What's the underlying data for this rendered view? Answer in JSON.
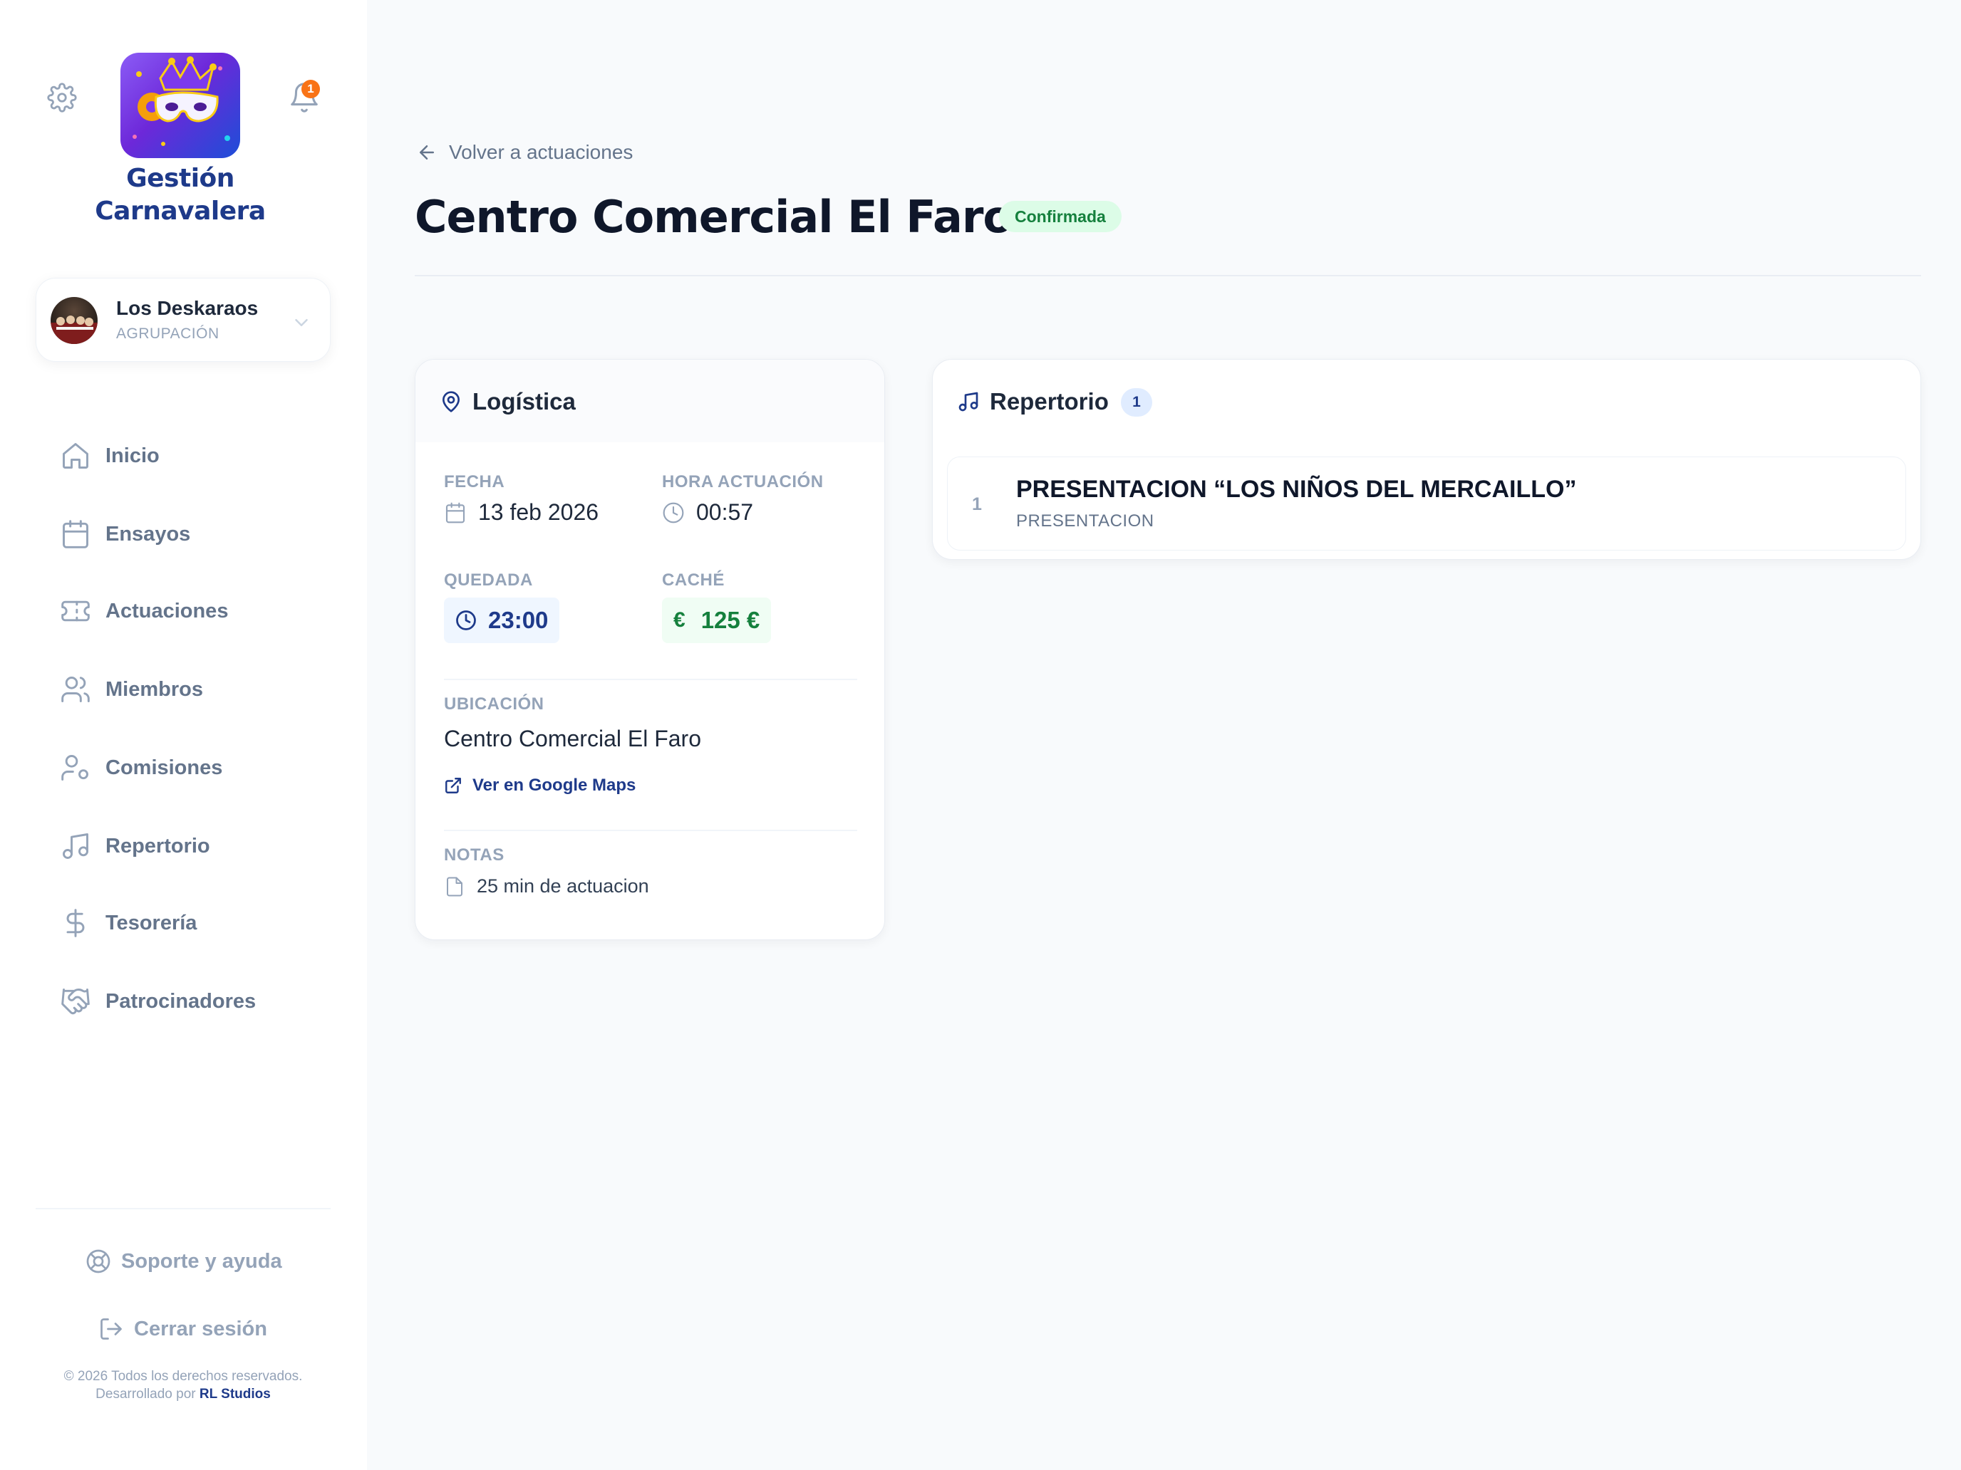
{
  "app": {
    "logo_line1": "Gestión",
    "logo_line2": "Carnavalera",
    "notifications_count": "1"
  },
  "group": {
    "name": "Los Deskaraos",
    "type": "AGRUPACIÓN"
  },
  "nav": {
    "items": [
      {
        "label": "Inicio",
        "icon": "home-icon"
      },
      {
        "label": "Ensayos",
        "icon": "calendar-icon"
      },
      {
        "label": "Actuaciones",
        "icon": "ticket-icon"
      },
      {
        "label": "Miembros",
        "icon": "users-icon"
      },
      {
        "label": "Comisiones",
        "icon": "user-cog-icon"
      },
      {
        "label": "Repertorio",
        "icon": "music-icon"
      },
      {
        "label": "Tesorería",
        "icon": "dollar-icon"
      },
      {
        "label": "Patrocinadores",
        "icon": "handshake-icon"
      }
    ]
  },
  "footer": {
    "support": "Soporte y ayuda",
    "logout": "Cerrar sesión",
    "copyright": "© 2026 Todos los derechos reservados.",
    "developed_by": "Desarrollado por",
    "studio": "RL Studios"
  },
  "page": {
    "back_label": "Volver a actuaciones",
    "title": "Centro Comercial El Faro",
    "status": "Confirmada"
  },
  "logistics": {
    "title": "Logística",
    "date_label": "FECHA",
    "date_value": "13 feb 2026",
    "time_label": "HORA ACTUACIÓN",
    "time_value": "00:57",
    "meet_label": "QUEDADA",
    "meet_value": "23:00",
    "fee_label": "CACHÉ",
    "fee_symbol": "€",
    "fee_value": "125 €",
    "location_label": "UBICACIÓN",
    "location_value": "Centro Comercial El Faro",
    "maps_link": "Ver en Google Maps",
    "notes_label": "NOTAS",
    "notes_value": "25 min de actuacion"
  },
  "repertoire": {
    "title": "Repertorio",
    "count": "1",
    "songs": [
      {
        "number": "1",
        "title": "PRESENTACION “LOS NIÑOS DEL MERCAILLO”",
        "type": "PRESENTACION"
      }
    ]
  },
  "colors": {
    "brand": "#1e3a8a",
    "badge_confirmed_bg": "#dcfce7",
    "badge_confirmed_fg": "#15803d",
    "notification": "#f97316",
    "muted": "#94a3b8"
  }
}
